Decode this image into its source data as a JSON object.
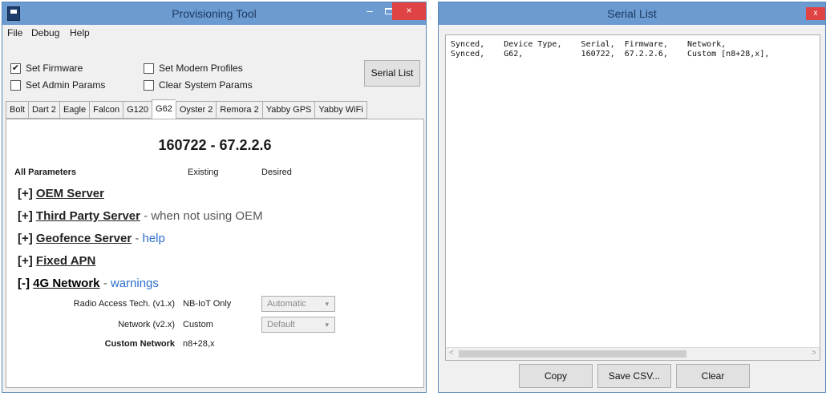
{
  "left_window": {
    "title": "Provisioning Tool",
    "controls": {
      "minimize": "–",
      "close": "×"
    },
    "menu": [
      "File",
      "Debug",
      "Help"
    ],
    "options": [
      {
        "label": "Set Firmware",
        "checked": true
      },
      {
        "label": "Set Modem Profiles",
        "checked": false
      },
      {
        "label": "Set Admin Params",
        "checked": false
      },
      {
        "label": "Clear System Params",
        "checked": false
      }
    ],
    "serial_list_button": "Serial List",
    "tabs": [
      "Bolt",
      "Dart 2",
      "Eagle",
      "Falcon",
      "G120",
      "G62",
      "Oyster 2",
      "Remora 2",
      "Yabby GPS",
      "Yabby WiFi"
    ],
    "active_tab": "G62",
    "device_heading": "160722 - 67.2.2.6",
    "columns": {
      "all": "All Parameters",
      "existing": "Existing",
      "desired": "Desired"
    },
    "sections": [
      {
        "toggle": "[+]",
        "name": "OEM Server",
        "suffix": "",
        "link": ""
      },
      {
        "toggle": "[+]",
        "name": "Third Party Server",
        "suffix": "when not using OEM",
        "link": ""
      },
      {
        "toggle": "[+]",
        "name": "Geofence Server",
        "suffix": "",
        "link": "help"
      },
      {
        "toggle": "[+]",
        "name": "Fixed APN",
        "suffix": "",
        "link": ""
      },
      {
        "toggle": "[-]",
        "name": "4G Network",
        "suffix": "",
        "link": "warnings"
      }
    ],
    "network_rows": [
      {
        "label": "Radio Access Tech. (v1.x)",
        "existing": "NB-IoT Only",
        "desired": "Automatic"
      },
      {
        "label": "Network (v2.x)",
        "existing": "Custom",
        "desired": "Default"
      },
      {
        "label": "Custom Network",
        "existing": "n8+28,x",
        "desired": ""
      }
    ],
    "dash": "-"
  },
  "right_window": {
    "title": "Serial List",
    "close": "x",
    "lines": [
      "Synced,    Device Type,    Serial,  Firmware,    Network,",
      "Synced,    G62,            160722,  67.2.2.6,    Custom [n8+28,x],"
    ],
    "buttons": {
      "copy": "Copy",
      "save_csv": "Save CSV...",
      "clear": "Clear"
    },
    "scroll_left": "<",
    "scroll_right": ">"
  },
  "colors": {
    "titlebar": "#6b9bd1",
    "close": "#e04343",
    "link": "#2c6ecb"
  },
  "icons": [
    "app-icon",
    "minimize-icon",
    "maximize-icon",
    "close-icon",
    "chevron-down-icon"
  ]
}
